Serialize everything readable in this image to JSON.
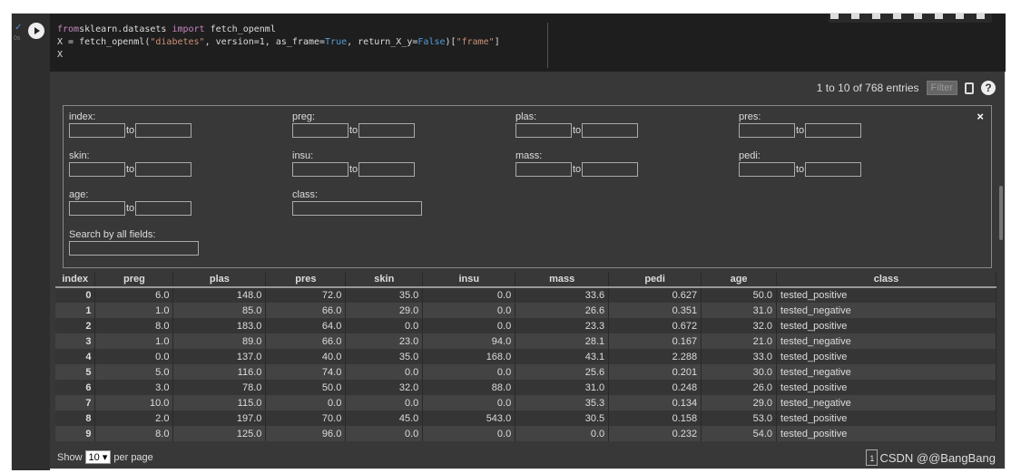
{
  "code": {
    "lines": [
      [
        [
          "kw",
          "from"
        ],
        [
          "",
          "sklearn.datasets "
        ],
        [
          "kw",
          "import"
        ],
        [
          "",
          " fetch_openml"
        ]
      ],
      [
        [
          "",
          "X = fetch_openml("
        ],
        [
          "str",
          "\"diabetes\""
        ],
        [
          "",
          ", version=1, as_frame="
        ],
        [
          "bl",
          "True"
        ],
        [
          "",
          ", return_X_y="
        ],
        [
          "bl",
          "False"
        ],
        [
          "",
          ")["
        ],
        [
          "str",
          "\"frame\""
        ],
        [
          "",
          "]"
        ]
      ],
      [
        [
          "",
          "X"
        ]
      ]
    ],
    "exec_time": "0s"
  },
  "output": {
    "entries": "1 to 10 of 768 entries",
    "filter_label": "Filter",
    "close": "×",
    "help": "?"
  },
  "filters": {
    "range": [
      "index:",
      "preg:",
      "plas:",
      "pres:",
      "skin:",
      "insu:",
      "mass:",
      "pedi:",
      "age:"
    ],
    "to": "to",
    "class": "class:",
    "search": "Search by all fields:"
  },
  "table": {
    "columns": [
      "index",
      "preg",
      "plas",
      "pres",
      "skin",
      "insu",
      "mass",
      "pedi",
      "age",
      "class"
    ],
    "rows": [
      [
        "0",
        "6.0",
        "148.0",
        "72.0",
        "35.0",
        "0.0",
        "33.6",
        "0.627",
        "50.0",
        "tested_positive"
      ],
      [
        "1",
        "1.0",
        "85.0",
        "66.0",
        "29.0",
        "0.0",
        "26.6",
        "0.351",
        "31.0",
        "tested_negative"
      ],
      [
        "2",
        "8.0",
        "183.0",
        "64.0",
        "0.0",
        "0.0",
        "23.3",
        "0.672",
        "32.0",
        "tested_positive"
      ],
      [
        "3",
        "1.0",
        "89.0",
        "66.0",
        "23.0",
        "94.0",
        "28.1",
        "0.167",
        "21.0",
        "tested_negative"
      ],
      [
        "4",
        "0.0",
        "137.0",
        "40.0",
        "35.0",
        "168.0",
        "43.1",
        "2.288",
        "33.0",
        "tested_positive"
      ],
      [
        "5",
        "5.0",
        "116.0",
        "74.0",
        "0.0",
        "0.0",
        "25.6",
        "0.201",
        "30.0",
        "tested_negative"
      ],
      [
        "6",
        "3.0",
        "78.0",
        "50.0",
        "32.0",
        "88.0",
        "31.0",
        "0.248",
        "26.0",
        "tested_positive"
      ],
      [
        "7",
        "10.0",
        "115.0",
        "0.0",
        "0.0",
        "0.0",
        "35.3",
        "0.134",
        "29.0",
        "tested_negative"
      ],
      [
        "8",
        "2.0",
        "197.0",
        "70.0",
        "45.0",
        "543.0",
        "30.5",
        "0.158",
        "53.0",
        "tested_positive"
      ],
      [
        "9",
        "8.0",
        "125.0",
        "96.0",
        "0.0",
        "0.0",
        "0.0",
        "0.232",
        "54.0",
        "tested_positive"
      ]
    ]
  },
  "footer": {
    "show": "Show",
    "per_page_value": "10 ▾",
    "per_page": "per page",
    "page": "1",
    "watermark": "CSDN @@BangBang"
  }
}
